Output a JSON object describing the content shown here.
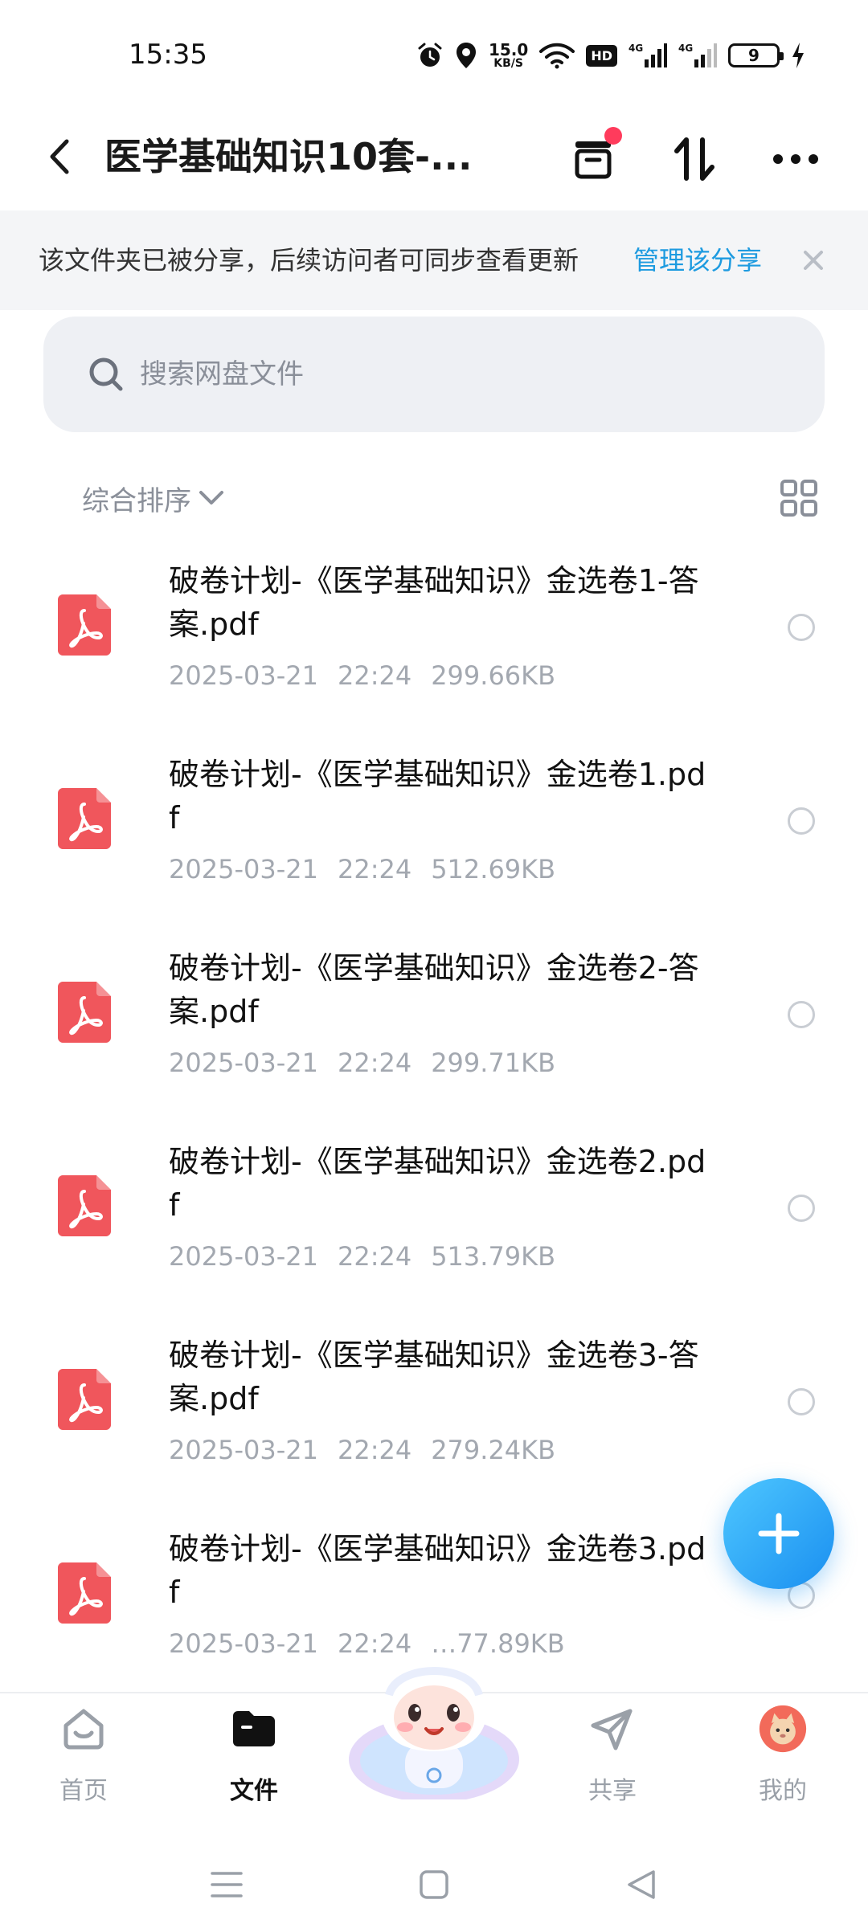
{
  "status_bar": {
    "time": "15:35",
    "net_speed": "15.0",
    "net_speed_unit": "KB/S",
    "hd_badge": "HD",
    "signal_1": "4G",
    "signal_2": "4G",
    "battery": "9"
  },
  "header": {
    "title": "医学基础知识10套-..."
  },
  "share_banner": {
    "text": "该文件夹已被分享，后续访问者可同步查看更新",
    "manage_label": "管理该分享"
  },
  "search": {
    "placeholder": "搜索网盘文件"
  },
  "sort": {
    "label": "综合排序"
  },
  "files": [
    {
      "name": "破卷计划-《医学基础知识》金选卷1-答案.pdf",
      "date": "2025-03-21",
      "time": "22:24",
      "size": "299.66KB"
    },
    {
      "name": "破卷计划-《医学基础知识》金选卷1.pdf",
      "date": "2025-03-21",
      "time": "22:24",
      "size": "512.69KB"
    },
    {
      "name": "破卷计划-《医学基础知识》金选卷2-答案.pdf",
      "date": "2025-03-21",
      "time": "22:24",
      "size": "299.71KB"
    },
    {
      "name": "破卷计划-《医学基础知识》金选卷2.pdf",
      "date": "2025-03-21",
      "time": "22:24",
      "size": "513.79KB"
    },
    {
      "name": "破卷计划-《医学基础知识》金选卷3-答案.pdf",
      "date": "2025-03-21",
      "time": "22:24",
      "size": "279.24KB"
    },
    {
      "name": "破卷计划-《医学基础知识》金选卷3.pdf",
      "date": "2025-03-21",
      "time": "22:24",
      "size": "…77.89KB"
    }
  ],
  "bottom_nav": {
    "home": "首页",
    "files": "文件",
    "share": "共享",
    "mine": "我的",
    "active": "files"
  },
  "colors": {
    "accent": "#1e9be0",
    "pdf_icon": "#f0565c",
    "notify_dot": "#ff3b5c"
  }
}
